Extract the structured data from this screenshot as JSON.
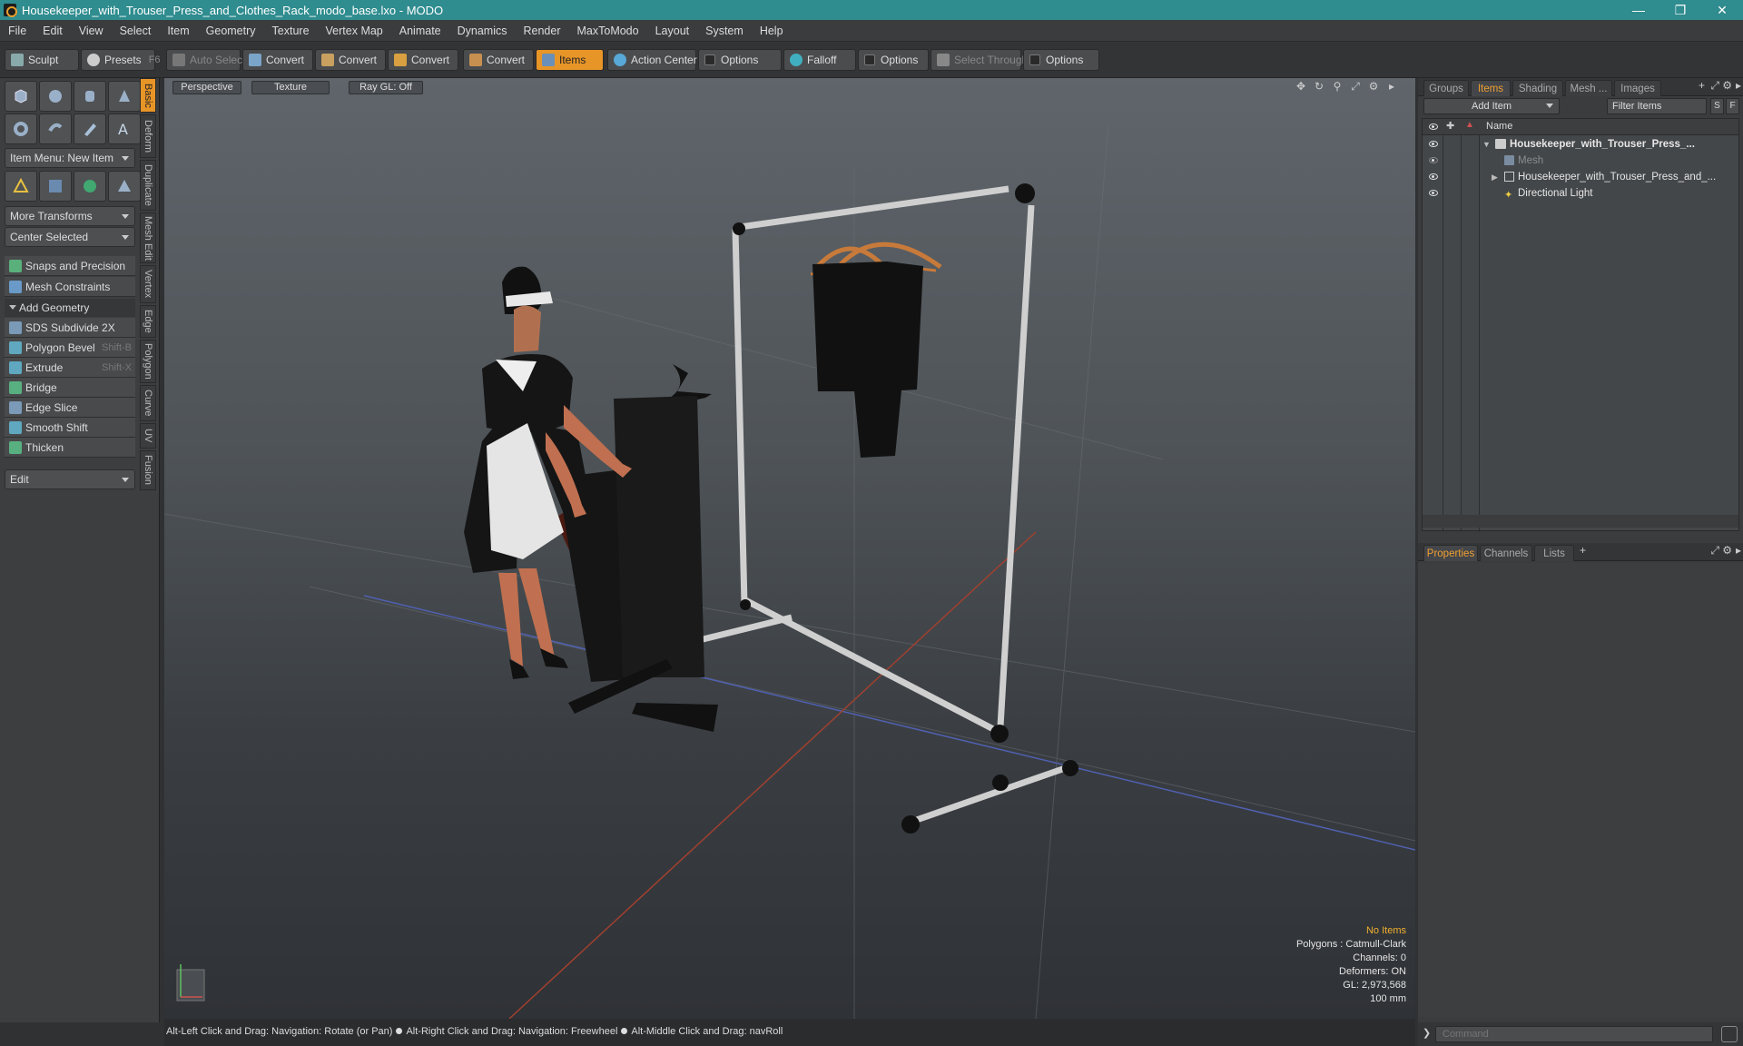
{
  "window": {
    "title": "Housekeeper_with_Trouser_Press_and_Clothes_Rack_modo_base.lxo - MODO"
  },
  "menu": [
    "File",
    "Edit",
    "View",
    "Select",
    "Item",
    "Geometry",
    "Texture",
    "Vertex Map",
    "Animate",
    "Dynamics",
    "Render",
    "MaxToModo",
    "Layout",
    "System",
    "Help"
  ],
  "toolbar": {
    "sculpt": "Sculpt",
    "presets": "Presets",
    "presets_key": "F6",
    "auto_select": "Auto Select",
    "convert1": "Convert",
    "convert2": "Convert",
    "convert3": "Convert",
    "convert4": "Convert",
    "items": "Items",
    "action_center": "Action Center",
    "options1": "Options",
    "falloff": "Falloff",
    "options2": "Options",
    "select_through": "Select Through",
    "options3": "Options"
  },
  "left_panel": {
    "item_menu": "Item Menu: New Item",
    "more_transforms": "More Transforms",
    "center_selected": "Center Selected",
    "snaps": "Snaps and Precision",
    "mesh_constraints": "Mesh Constraints",
    "add_geometry": "Add Geometry",
    "tools": [
      {
        "label": "SDS Subdivide 2X",
        "key": ""
      },
      {
        "label": "Polygon Bevel",
        "key": "Shift-B"
      },
      {
        "label": "Extrude",
        "key": "Shift-X"
      },
      {
        "label": "Bridge",
        "key": ""
      },
      {
        "label": "Edge Slice",
        "key": ""
      },
      {
        "label": "Smooth Shift",
        "key": ""
      },
      {
        "label": "Thicken",
        "key": ""
      }
    ],
    "edit": "Edit",
    "vertical_tabs": [
      "Basic",
      "Deform",
      "Duplicate",
      "Mesh Edit",
      "Vertex",
      "Edge",
      "Polygon",
      "Curve",
      "UV",
      "Fusion"
    ]
  },
  "viewport": {
    "view_mode": "Perspective",
    "shading": "Texture",
    "raygl": "Ray GL: Off",
    "stats": {
      "selection": "No Items",
      "polygons": "Polygons : Catmull-Clark",
      "channels": "Channels: 0",
      "deformers": "Deformers: ON",
      "gl": "GL: 2,973,568",
      "grid": "100 mm"
    }
  },
  "status_bar": {
    "hint1": "Alt-Left Click and Drag: Navigation: Rotate (or Pan)",
    "hint2": "Alt-Right Click and Drag: Navigation: Freewheel",
    "hint3": "Alt-Middle Click and Drag: navRoll"
  },
  "right_panel": {
    "top_tabs": [
      "Groups",
      "Items",
      "Shading",
      "Mesh ...",
      "Images"
    ],
    "add_item": "Add Item",
    "filter_items": "Filter Items",
    "btn_s": "S",
    "btn_f": "F",
    "name_col": "Name",
    "tree": [
      {
        "label": "Housekeeper_with_Trouser_Press_...",
        "indent": 0
      },
      {
        "label": "Mesh",
        "indent": 1
      },
      {
        "label": "Housekeeper_with_Trouser_Press_and_...",
        "indent": 1
      },
      {
        "label": "Directional Light",
        "indent": 1
      }
    ],
    "bottom_tabs": [
      "Properties",
      "Channels",
      "Lists"
    ],
    "command_placeholder": "Command"
  },
  "colors": {
    "accent": "#e89528",
    "titlebar": "#2f8c8f"
  }
}
